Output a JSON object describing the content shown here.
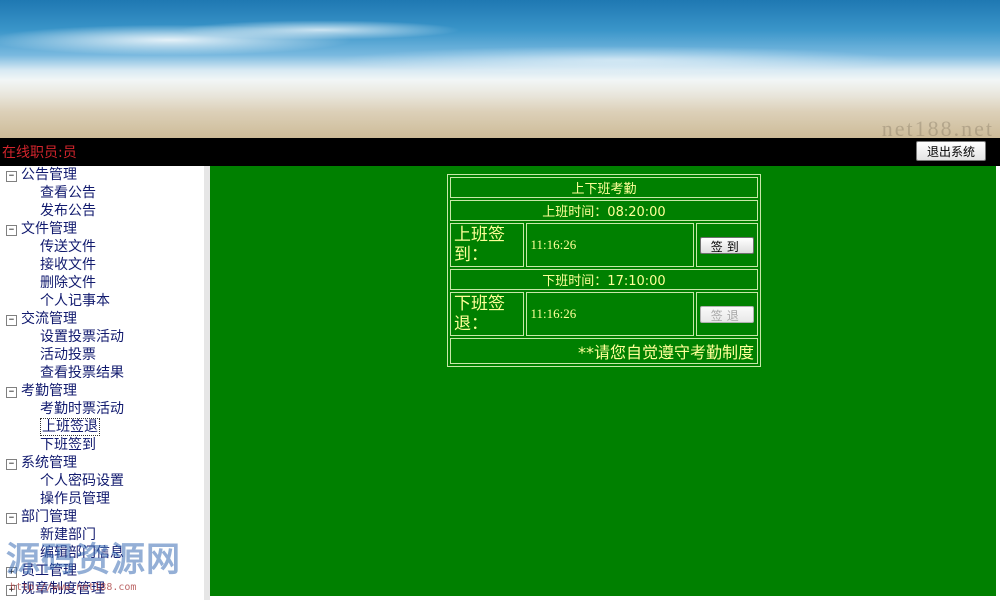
{
  "banner": {
    "watermark_text": "net188.net"
  },
  "header": {
    "online_label": "在线职员:员",
    "logout_label": "退出系统"
  },
  "sidebar": {
    "groups": [
      {
        "label": "公告管理",
        "expander": "⊟",
        "items": [
          "查看公告",
          "发布公告"
        ]
      },
      {
        "label": "文件管理",
        "expander": "⊟",
        "items": [
          "传送文件",
          "接收文件",
          "删除文件",
          "个人记事本"
        ]
      },
      {
        "label": "交流管理",
        "expander": "⊟",
        "items": [
          "设置投票活动",
          "活动投票",
          "查看投票结果"
        ]
      },
      {
        "label": "考勤管理",
        "expander": "⊟",
        "items": [
          "考勤时票活动",
          "上班签退",
          "下班签到"
        ]
      },
      {
        "label": "系统管理",
        "expander": "⊟",
        "items": [
          "个人密码设置",
          "操作员管理"
        ]
      },
      {
        "label": "部门管理",
        "expander": "⊟",
        "items": [
          "新建部门",
          "编辑部门信息"
        ]
      },
      {
        "label": "员工管理",
        "expander": "⊞",
        "items": []
      },
      {
        "label": "规章制度管理",
        "expander": "⊞",
        "items": []
      }
    ],
    "selected_item": "上班签退"
  },
  "watermark": {
    "brand": "源码资源网",
    "url": "http://www.net188.com"
  },
  "attendance": {
    "title": "上下班考勤",
    "on_duty_time": "上班时间：08:20:00",
    "sign_in_label": "上班签到：",
    "sign_in_time": "11:16:26",
    "sign_in_button": "签到",
    "off_duty_time": "下班时间：17:10:00",
    "sign_out_label": "下班签退：",
    "sign_out_time": "11:16:26",
    "sign_out_button": "签退",
    "footer": "**请您自觉遵守考勤制度"
  },
  "colors": {
    "content_bg": "#008000",
    "text_yellow": "#ffff99",
    "online_red": "#d0242c",
    "nav_text": "#111a6e"
  }
}
